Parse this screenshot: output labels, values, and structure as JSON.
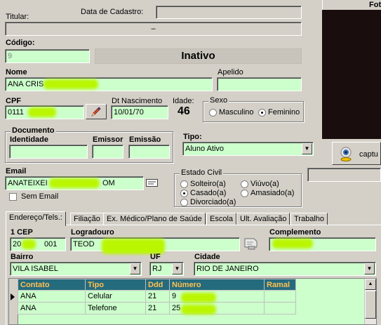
{
  "header": {
    "titular_label": "Titular:",
    "data_cadastro_label": "Data de Cadastro:",
    "dash": "–",
    "codigo_label": "Código:",
    "codigo_value": "9",
    "status": "Inativo"
  },
  "photo": {
    "title": "Fot",
    "capture_label": "captu"
  },
  "form": {
    "nome_label": "Nome",
    "nome_value": "ANA CRIS",
    "apelido_label": "Apelido",
    "apelido_value": "",
    "cpf_label": "CPF",
    "cpf_value": "0111",
    "dt_nasc_label": "Dt Nascimento",
    "dt_nasc_value": "10/01/70",
    "idade_label": "Idade:",
    "idade_value": "46",
    "sexo": {
      "title": "Sexo",
      "options": [
        "Masculino",
        "Feminino"
      ],
      "selected": "Feminino"
    },
    "documento": {
      "title": "Documento",
      "identidade_label": "Identidade",
      "emissor_label": "Emissor",
      "emissao_label": "Emissão"
    },
    "tipo_label": "Tipo:",
    "tipo_value": "Aluno Ativo",
    "email_label": "Email",
    "email_value": "ANATEIXEI",
    "email_value_end": "OM",
    "sem_email_label": "Sem Email",
    "estado_civil": {
      "title": "Estado Civil",
      "options": [
        "Solteiro(a)",
        "Casado(a)",
        "Divorciado(a)",
        "Viúvo(a)",
        "Amasiado(a)"
      ],
      "selected": "Casado(a)"
    }
  },
  "tabs": [
    "Endereço/Tels.:",
    "Filiação",
    "Ex. Médico/Plano de Saúde",
    "Escola",
    "Ult. Avaliação",
    "Trabalho"
  ],
  "address": {
    "cep_label": "1 CEP",
    "cep_value": "20",
    "cep_value_end": "001",
    "logradouro_label": "Logradouro",
    "logradouro_value": "TEOD",
    "complemento_label": "Complemento",
    "complemento_value": "",
    "bairro_label": "Bairro",
    "bairro_value": "VILA ISABEL",
    "uf_label": "UF",
    "uf_value": "RJ",
    "cidade_label": "Cidade",
    "cidade_value": "RIO DE JANEIRO"
  },
  "contacts": {
    "headers": [
      "Contato",
      "Tipo",
      "Ddd",
      "Número",
      "Ramal"
    ],
    "rows": [
      {
        "contato": "ANA",
        "tipo": "Celular",
        "ddd": "21",
        "numero": "9",
        "ramal": ""
      },
      {
        "contato": "ANA",
        "tipo": "Telefone",
        "ddd": "21",
        "numero": "25",
        "ramal": ""
      }
    ]
  },
  "colors": {
    "field_bg": "#ccffcc",
    "grid_header_bg": "#256b7e",
    "grid_header_text": "#ffc04f",
    "window_bg": "#d4d0c8"
  }
}
